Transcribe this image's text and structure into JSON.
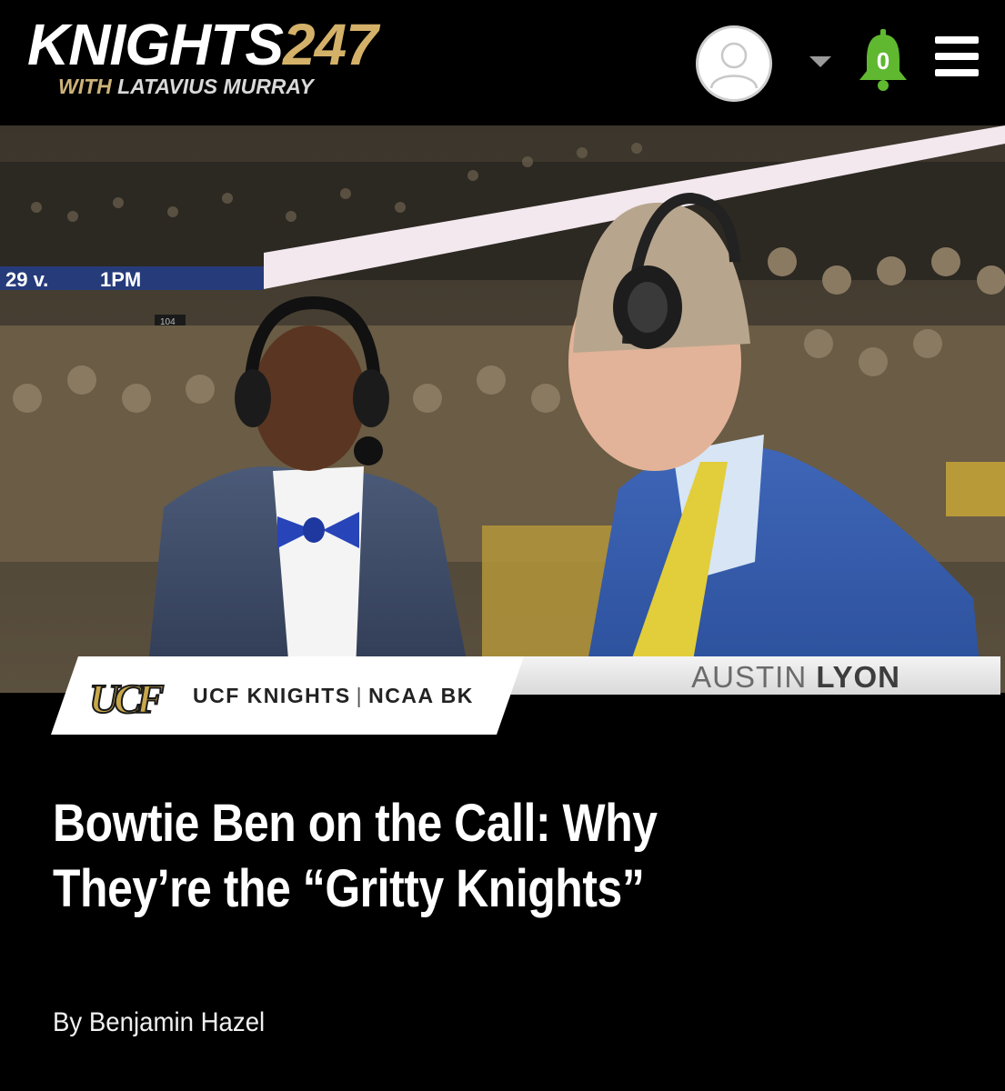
{
  "header": {
    "brand_main": "KNIGHTS",
    "brand_number": "247",
    "brand_with": "WITH",
    "brand_partner": "LATAVIUS MURRAY",
    "notification_count": "0"
  },
  "hero": {
    "scoreboard_text": "29 v. ",
    "scoreboard_time": "1PM",
    "section_sign": "104",
    "lower_third_first": "AUSTIN",
    "lower_third_last": "LYON"
  },
  "article": {
    "category_team": "UCF KNIGHTS",
    "category_separator": "|",
    "category_sport": "NCAA BK",
    "title_line1": "Bowtie Ben on the Call: Why",
    "title_line2": "They’re the “Gritty Knights”",
    "byline": "By Benjamin Hazel"
  },
  "colors": {
    "brand_gold": "#d4b169",
    "notification_green": "#5fb830",
    "background": "#000000"
  },
  "icons": {
    "avatar": "user-avatar-icon",
    "dropdown": "caret-down-icon",
    "notifications": "bell-icon",
    "menu": "hamburger-menu-icon",
    "logo": "ucf-logo-icon"
  }
}
